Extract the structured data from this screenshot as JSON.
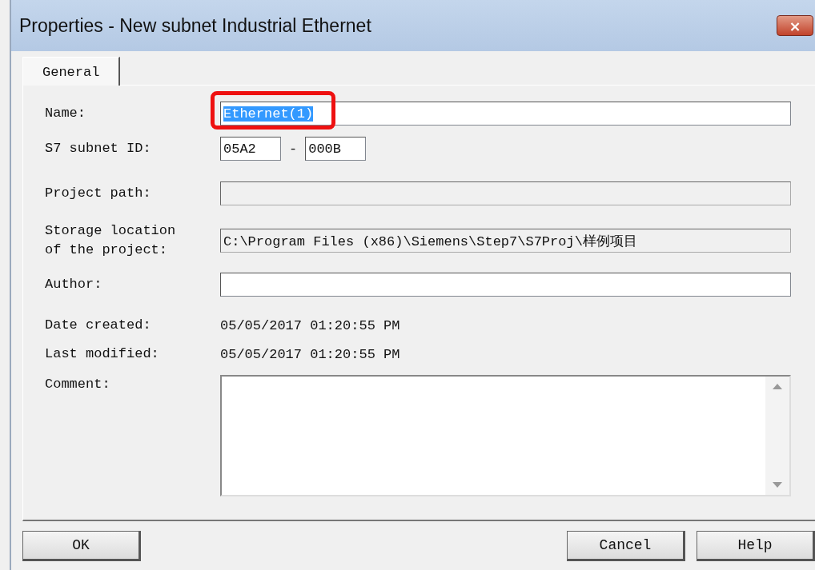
{
  "window": {
    "title": "Properties -  New subnet Industrial Ethernet",
    "close_label": "×"
  },
  "tabs": [
    {
      "label": "General"
    }
  ],
  "rows": [
    {
      "kind": "text",
      "label": "Name:",
      "value": "Ethernet(1)",
      "text_selected": true,
      "annotated": true
    },
    {
      "kind": "id",
      "label": "S7 subnet ID:",
      "parts": [
        "05A2",
        "000B"
      ],
      "separator": "-"
    },
    {
      "kind": "readonly",
      "label": "Project path:"
    },
    {
      "kind": "readonly",
      "label": "Storage location\nof the project:",
      "value": "C:\\Program Files (x86)\\Siemens\\Step7\\S7Proj\\样例项目"
    },
    {
      "kind": "text",
      "label": "Author:"
    },
    {
      "kind": "info",
      "label": "Date created:",
      "value": "05/05/2017 01:20:55 PM"
    },
    {
      "kind": "info",
      "label": "Last modified:",
      "value": "05/05/2017 01:20:55 PM"
    },
    {
      "kind": "memo",
      "label": "Comment:"
    }
  ],
  "buttons": [
    {
      "label": "OK",
      "kind": "left"
    },
    {
      "label": "Cancel",
      "kind": "right"
    },
    {
      "label": "Help",
      "kind": "right"
    }
  ]
}
